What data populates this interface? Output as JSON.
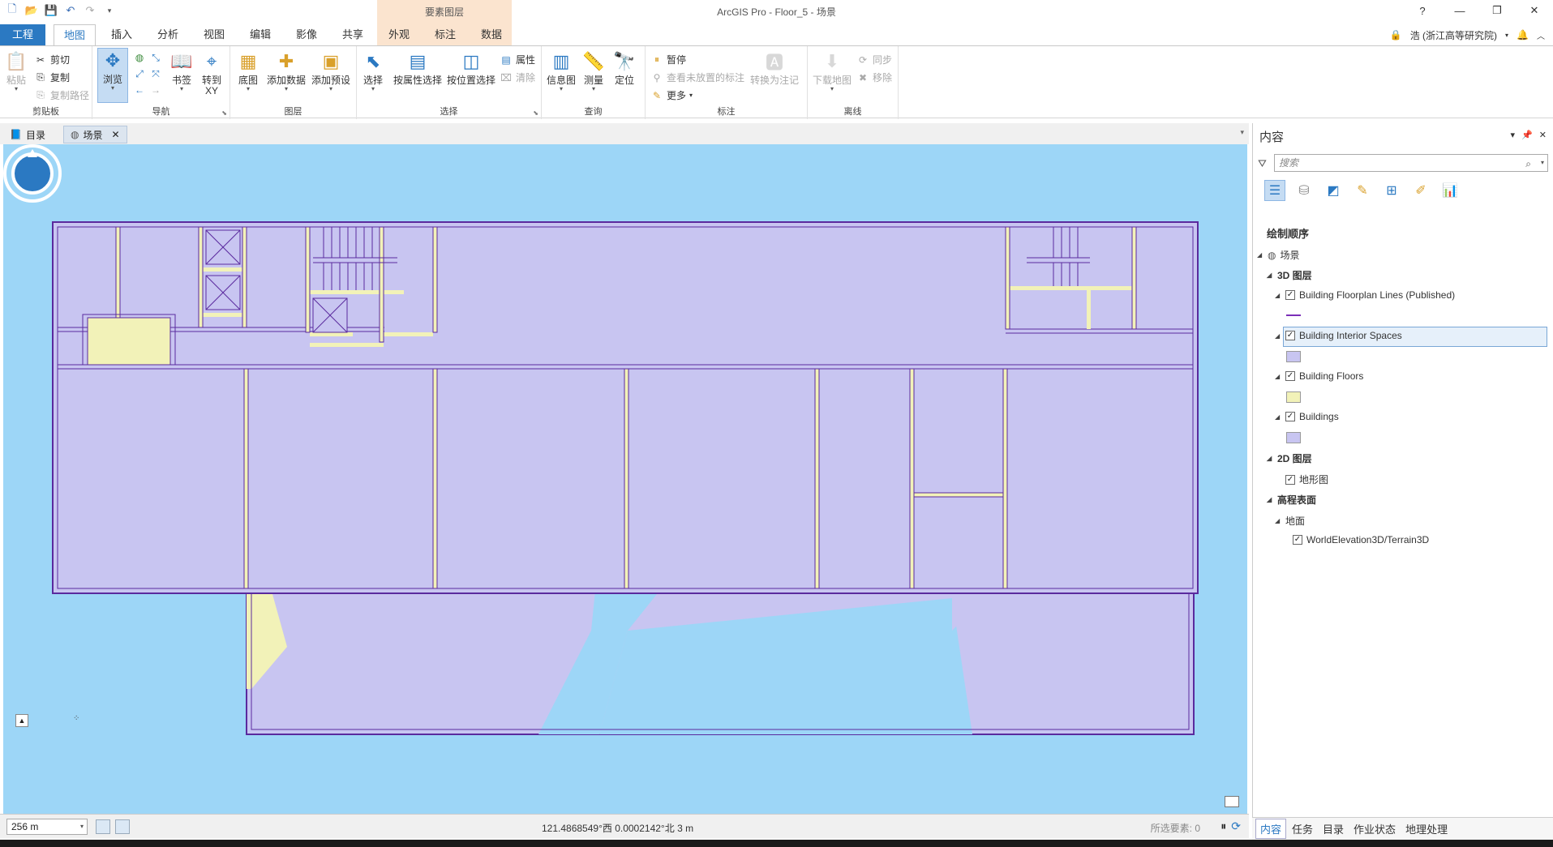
{
  "app": {
    "title": "ArcGIS Pro - Floor_5 - 场景",
    "context_tab_group": "要素图层"
  },
  "window_controls": [
    "?",
    "—",
    "❐",
    "✕"
  ],
  "user": {
    "name": "浩 (浙江高等研究院)"
  },
  "tabs": [
    {
      "label": "工程"
    },
    {
      "label": "地图"
    },
    {
      "label": "插入"
    },
    {
      "label": "分析"
    },
    {
      "label": "视图"
    },
    {
      "label": "编辑"
    },
    {
      "label": "影像"
    },
    {
      "label": "共享"
    },
    {
      "label": "外观"
    },
    {
      "label": "标注"
    },
    {
      "label": "数据"
    }
  ],
  "ribbon": {
    "clipboard": {
      "label": "剪贴板",
      "paste": "粘贴",
      "cut": "剪切",
      "copy": "复制",
      "copy_path": "复制路径"
    },
    "navigate": {
      "label": "导航",
      "explore": "浏览",
      "bookmarks": "书签",
      "goto_xy": "转到\nXY"
    },
    "layer": {
      "label": "图层",
      "basemap": "底图",
      "add_data": "添加数据",
      "add_preset": "添加预设"
    },
    "selection": {
      "label": "选择",
      "select": "选择",
      "by_attr": "按属性选择",
      "by_location": "按位置选择",
      "attributes": "属性",
      "clear": "清除"
    },
    "inquiry": {
      "label": "查询",
      "infographic": "信息图",
      "measure": "测量",
      "locate": "定位"
    },
    "labeling": {
      "label": "标注",
      "pause": "暂停",
      "view_unplaced": "查看未放置的标注",
      "more": "更多",
      "convert": "转换为注记"
    },
    "offline": {
      "label": "离线",
      "download": "下载地图",
      "sync": "同步",
      "remove": "移除"
    }
  },
  "view_tabs": [
    {
      "label": "目录"
    },
    {
      "label": "场景"
    }
  ],
  "status": {
    "scale": "256 m",
    "coordinates": "121.4868549°西 0.0002142°北   3 m",
    "selected_features": "所选要素: 0"
  },
  "contents": {
    "title": "内容",
    "search_placeholder": "搜索",
    "drawing_order": "绘制顺序",
    "scene": "场景",
    "group_3d": "3D 图层",
    "layers_3d": [
      {
        "name": "Building Floorplan Lines (Published)",
        "checked": true,
        "symbol": "line",
        "color": "#7b2fb8"
      },
      {
        "name": "Building Interior Spaces",
        "checked": true,
        "symbol": "fill",
        "color": "#c8c5f1"
      },
      {
        "name": "Building Floors",
        "checked": true,
        "symbol": "fill",
        "color": "#f2f2b8"
      },
      {
        "name": "Buildings",
        "checked": true,
        "symbol": "fill",
        "color": "#c8c5f1"
      }
    ],
    "group_2d": "2D 图层",
    "layers_2d": [
      {
        "name": "地形图",
        "checked": true
      }
    ],
    "elevation_group": "高程表面",
    "ground": "地面",
    "elevation_source": "WorldElevation3D/Terrain3D",
    "bottom_tabs": [
      "内容",
      "任务",
      "目录",
      "作业状态",
      "地理处理"
    ]
  },
  "colors": {
    "accent": "#2b79c2",
    "map_background": "#9dd6f7",
    "space_fill": "#c8c5f1",
    "floor_fill": "#f2f2b8",
    "line": "#5a2a9e"
  }
}
